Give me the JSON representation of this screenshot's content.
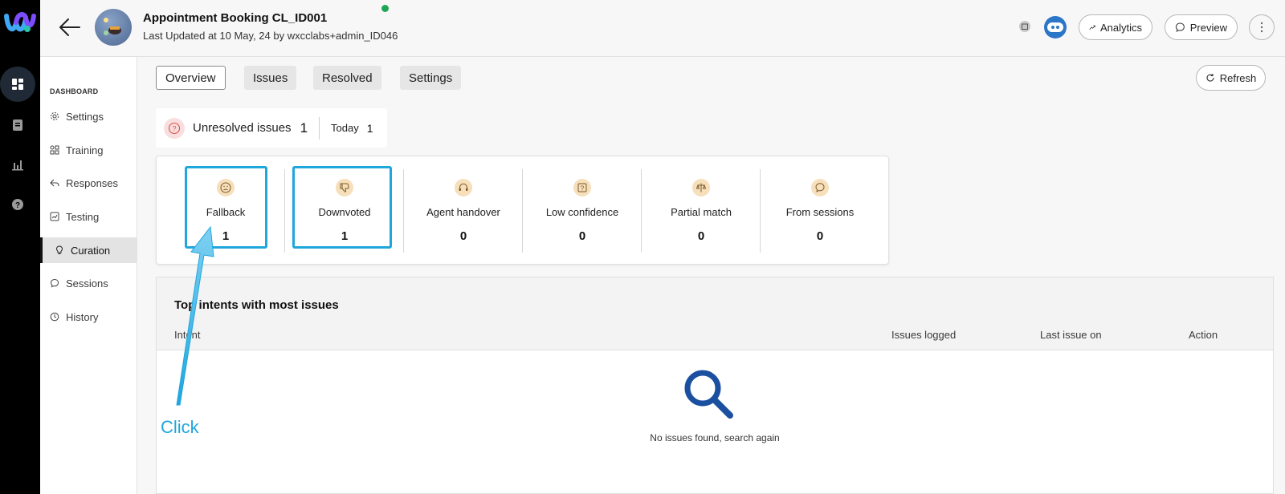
{
  "header": {
    "title": "Appointment Booking CL_ID001",
    "subtitle": "Last Updated at 10 May, 24 by wxcclabs+admin_ID046",
    "analytics_label": "Analytics",
    "preview_label": "Preview"
  },
  "sidebar": {
    "section": "DASHBOARD",
    "items": [
      {
        "label": "Settings",
        "icon": "gear-icon"
      },
      {
        "label": "Training",
        "icon": "training-icon"
      },
      {
        "label": "Responses",
        "icon": "reply-icon"
      },
      {
        "label": "Testing",
        "icon": "testing-icon"
      },
      {
        "label": "Curation",
        "icon": "bulb-icon",
        "active": true
      },
      {
        "label": "Sessions",
        "icon": "chat-icon"
      },
      {
        "label": "History",
        "icon": "history-icon"
      }
    ]
  },
  "tabs": [
    {
      "label": "Overview",
      "active": true
    },
    {
      "label": "Issues"
    },
    {
      "label": "Resolved"
    },
    {
      "label": "Settings"
    }
  ],
  "refresh_label": "Refresh",
  "summary": {
    "label": "Unresolved issues",
    "count": "1",
    "today_label": "Today",
    "today_count": "1"
  },
  "cards": [
    {
      "label": "Fallback",
      "value": "1",
      "icon": "sad-face-icon"
    },
    {
      "label": "Downvoted",
      "value": "1",
      "icon": "thumbs-down-icon"
    },
    {
      "label": "Agent handover",
      "value": "0",
      "icon": "headset-icon"
    },
    {
      "label": "Low confidence",
      "value": "0",
      "icon": "question-box-icon"
    },
    {
      "label": "Partial match",
      "value": "0",
      "icon": "scale-icon"
    },
    {
      "label": "From sessions",
      "value": "0",
      "icon": "chat-bubble-icon"
    }
  ],
  "panel": {
    "title": "Top intents with most issues",
    "columns": [
      "Intent",
      "Issues logged",
      "Last issue on",
      "Action"
    ],
    "empty_text": "No issues found, search again"
  },
  "annotation": {
    "label": "Click",
    "color": "#1fa6dd"
  }
}
